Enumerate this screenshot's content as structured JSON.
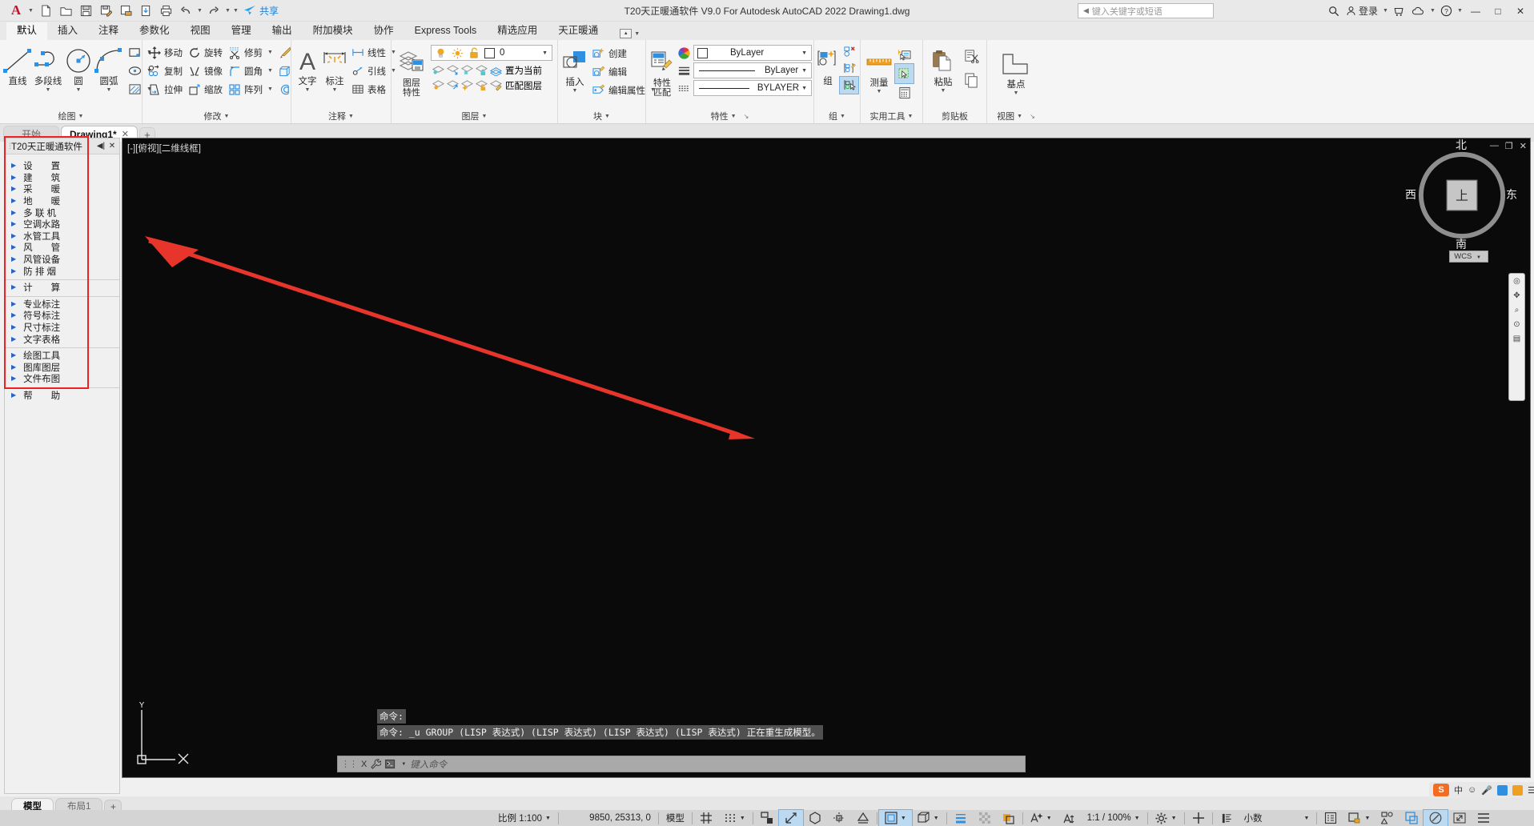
{
  "titlebar": {
    "app_icon": "autocad-a-icon",
    "quick_access": [
      {
        "name": "new-file",
        "icon": "new-document-icon"
      },
      {
        "name": "open-file",
        "icon": "open-folder-icon"
      },
      {
        "name": "save-file",
        "icon": "save-disk-icon"
      },
      {
        "name": "save-as",
        "icon": "save-as-icon"
      },
      {
        "name": "save-to-cloud",
        "icon": "save-cloud-icon"
      },
      {
        "name": "open-from-cloud",
        "icon": "open-cloud-icon"
      },
      {
        "name": "plot",
        "icon": "printer-icon"
      },
      {
        "name": "undo",
        "icon": "undo-arrow-icon"
      },
      {
        "name": "redo",
        "icon": "redo-arrow-icon"
      }
    ],
    "share_label": "共享",
    "title": "T20天正暖通软件 V9.0 For Autodesk AutoCAD 2022    Drawing1.dwg",
    "search_placeholder": "键入关键字或短语",
    "sign_in_label": "登录",
    "minimize": "—",
    "maximize": "□",
    "close": "✕"
  },
  "ribbon": {
    "tabs": [
      {
        "label": "默认",
        "active": true
      },
      {
        "label": "插入",
        "active": false
      },
      {
        "label": "注释",
        "active": false
      },
      {
        "label": "参数化",
        "active": false
      },
      {
        "label": "视图",
        "active": false
      },
      {
        "label": "管理",
        "active": false
      },
      {
        "label": "输出",
        "active": false
      },
      {
        "label": "附加模块",
        "active": false
      },
      {
        "label": "协作",
        "active": false
      },
      {
        "label": "Express Tools",
        "active": false
      },
      {
        "label": "精选应用",
        "active": false
      },
      {
        "label": "天正暖通",
        "active": false
      }
    ],
    "panels": {
      "draw": {
        "title": "绘图",
        "big": [
          {
            "label": "直线",
            "icon": "line-icon"
          },
          {
            "label": "多段线",
            "icon": "polyline-icon"
          },
          {
            "label": "圆",
            "icon": "circle-icon"
          },
          {
            "label": "圆弧",
            "icon": "arc-icon"
          }
        ],
        "small": [
          {
            "label": "",
            "icon": "rectangle-icon"
          },
          {
            "label": "",
            "icon": "ellipse-icon"
          },
          {
            "label": "",
            "icon": "hatch-icon"
          }
        ]
      },
      "modify": {
        "title": "修改",
        "items": [
          {
            "label": "移动",
            "icon": "move-icon"
          },
          {
            "label": "旋转",
            "icon": "rotate-icon"
          },
          {
            "label": "修剪",
            "icon": "trim-icon"
          },
          {
            "label": "复制",
            "icon": "copy-icon"
          },
          {
            "label": "镜像",
            "icon": "mirror-icon"
          },
          {
            "label": "圆角",
            "icon": "fillet-icon"
          },
          {
            "label": "拉伸",
            "icon": "stretch-icon"
          },
          {
            "label": "缩放",
            "icon": "scale-icon"
          },
          {
            "label": "阵列",
            "icon": "array-icon"
          }
        ],
        "extra": [
          {
            "label": "",
            "icon": "erase-brush-icon"
          },
          {
            "label": "",
            "icon": "3d-box-icon"
          },
          {
            "label": "",
            "icon": "offset-icon"
          }
        ]
      },
      "annotation": {
        "title": "注释",
        "text_label": "文字",
        "dim_label": "标注",
        "items": [
          {
            "label": "线性",
            "icon": "linear-dim-icon"
          },
          {
            "label": "引线",
            "icon": "leader-icon"
          },
          {
            "label": "表格",
            "icon": "table-icon"
          }
        ]
      },
      "layer": {
        "title": "图层",
        "big_label": "图层\n特性",
        "current_layer": "0",
        "set_current_label": "置为当前",
        "match_layer_label": "匹配图层"
      },
      "block": {
        "title": "块",
        "insert_label": "插入",
        "items": [
          {
            "label": "创建",
            "icon": "create-block-icon"
          },
          {
            "label": "编辑",
            "icon": "edit-block-icon"
          },
          {
            "label": "编辑属性",
            "icon": "edit-attribute-icon"
          }
        ]
      },
      "properties": {
        "title": "特性",
        "match_label": "特性\n匹配",
        "color": "ByLayer",
        "lineweight": "ByLayer",
        "linetype": "BYLAYER"
      },
      "group": {
        "title": "组",
        "label": "组"
      },
      "utilities": {
        "title": "实用工具",
        "label": "测量"
      },
      "clipboard": {
        "title": "剪贴板",
        "label": "粘贴"
      },
      "view": {
        "title": "视图",
        "label": "基点"
      }
    }
  },
  "file_tabs": {
    "start_tab": "开始",
    "tabs": [
      {
        "label": "Drawing1*",
        "active": true,
        "close": "✕"
      }
    ],
    "add_label": "+"
  },
  "palette": {
    "title": "T20天正暖通软件",
    "pin_icon": "auto-hide-icon",
    "close_icon": "close-icon",
    "groups": [
      {
        "items": [
          {
            "label": "设　　置"
          },
          {
            "label": "建　　筑"
          },
          {
            "label": "采　　暖"
          },
          {
            "label": "地　　暖"
          },
          {
            "label": "多 联 机"
          },
          {
            "label": "空调水路"
          },
          {
            "label": "水管工具"
          },
          {
            "label": "风　　管"
          },
          {
            "label": "风管设备"
          },
          {
            "label": "防 排 烟"
          }
        ]
      },
      {
        "items": [
          {
            "label": "计　　算"
          }
        ]
      },
      {
        "items": [
          {
            "label": "专业标注"
          },
          {
            "label": "符号标注"
          },
          {
            "label": "尺寸标注"
          },
          {
            "label": "文字表格"
          }
        ]
      },
      {
        "items": [
          {
            "label": "绘图工具"
          },
          {
            "label": "图库图层"
          },
          {
            "label": "文件布图"
          }
        ]
      },
      {
        "items": [
          {
            "label": "帮　　助"
          }
        ]
      }
    ]
  },
  "drawing": {
    "viewport_label": "[-][俯视][二维线框]",
    "viewcube": {
      "north": "北",
      "south": "南",
      "east": "东",
      "west": "西",
      "top": "上"
    },
    "wcs_label": "WCS",
    "accent_red": "#e8352c",
    "background": "#000000",
    "minimize": "—",
    "restore": "❐",
    "close": "✕"
  },
  "command": {
    "history": [
      "命令:",
      "命令: _u GROUP (LISP 表达式) (LISP 表达式) (LISP 表达式) (LISP 表达式) 正在重生成模型。"
    ],
    "placeholder": "键入命令",
    "close_icon": "X",
    "tools_icon": "wrench-icon",
    "prompt_icon": "command-prompt-icon"
  },
  "model_tabs": [
    {
      "label": "模型",
      "active": true
    },
    {
      "label": "布局1",
      "active": false
    }
  ],
  "model_tabs_add": "+",
  "statusbar": {
    "scale_label": "比例 1:100",
    "coordinates": "9850, 25313, 0",
    "space_label": "模型",
    "annotation_scale": "1:1 / 100%",
    "units": "小数",
    "items": [
      {
        "name": "grid-display",
        "icon": "grid-icon",
        "on": false
      },
      {
        "name": "snap-mode",
        "icon": "snap-dots-icon",
        "on": false
      },
      {
        "name": "ortho-mode",
        "icon": "ortho-icon",
        "on": false
      },
      {
        "name": "polar-tracking",
        "icon": "polar-icon",
        "on": true
      },
      {
        "name": "isometric-draft",
        "icon": "iso-icon",
        "on": false
      },
      {
        "name": "object-snap-tracking",
        "icon": "osnap-track-icon",
        "on": false
      },
      {
        "name": "object-snap",
        "icon": "osnap-icon",
        "on": true
      },
      {
        "name": "lineweight",
        "icon": "lineweight-icon",
        "on": false
      },
      {
        "name": "transparency",
        "icon": "transparency-icon",
        "on": false
      },
      {
        "name": "selection-cycling",
        "icon": "selection-cycling-icon",
        "on": false
      },
      {
        "name": "3d-osnap",
        "icon": "osnap-3d-icon",
        "on": false
      },
      {
        "name": "dynamic-ucs",
        "icon": "dynamic-ucs-icon",
        "on": false
      },
      {
        "name": "dynamic-input",
        "icon": "dynamic-input-icon",
        "on": false
      },
      {
        "name": "annotation-visibility",
        "icon": "annotation-visibility-icon",
        "on": false
      },
      {
        "name": "auto-scale",
        "icon": "auto-scale-icon",
        "on": false
      }
    ],
    "right_items": [
      {
        "name": "workspace-switching",
        "icon": "gear-icon"
      },
      {
        "name": "hardware-acceleration",
        "icon": "plus-icon"
      },
      {
        "name": "isolate-objects",
        "icon": "isolate-icon"
      },
      {
        "name": "lock-ui",
        "icon": "lock-ui-icon"
      },
      {
        "name": "graphics-performance",
        "icon": "performance-icon"
      },
      {
        "name": "clean-screen",
        "icon": "fullscreen-icon"
      },
      {
        "name": "customization",
        "icon": "hamburger-icon"
      }
    ],
    "ime": {
      "logo": "S",
      "lang_label": "中",
      "icons": [
        "smiley-icon",
        "mic-icon",
        "keyboard-icon",
        "toolbox-icon",
        "menu-icon"
      ]
    }
  }
}
